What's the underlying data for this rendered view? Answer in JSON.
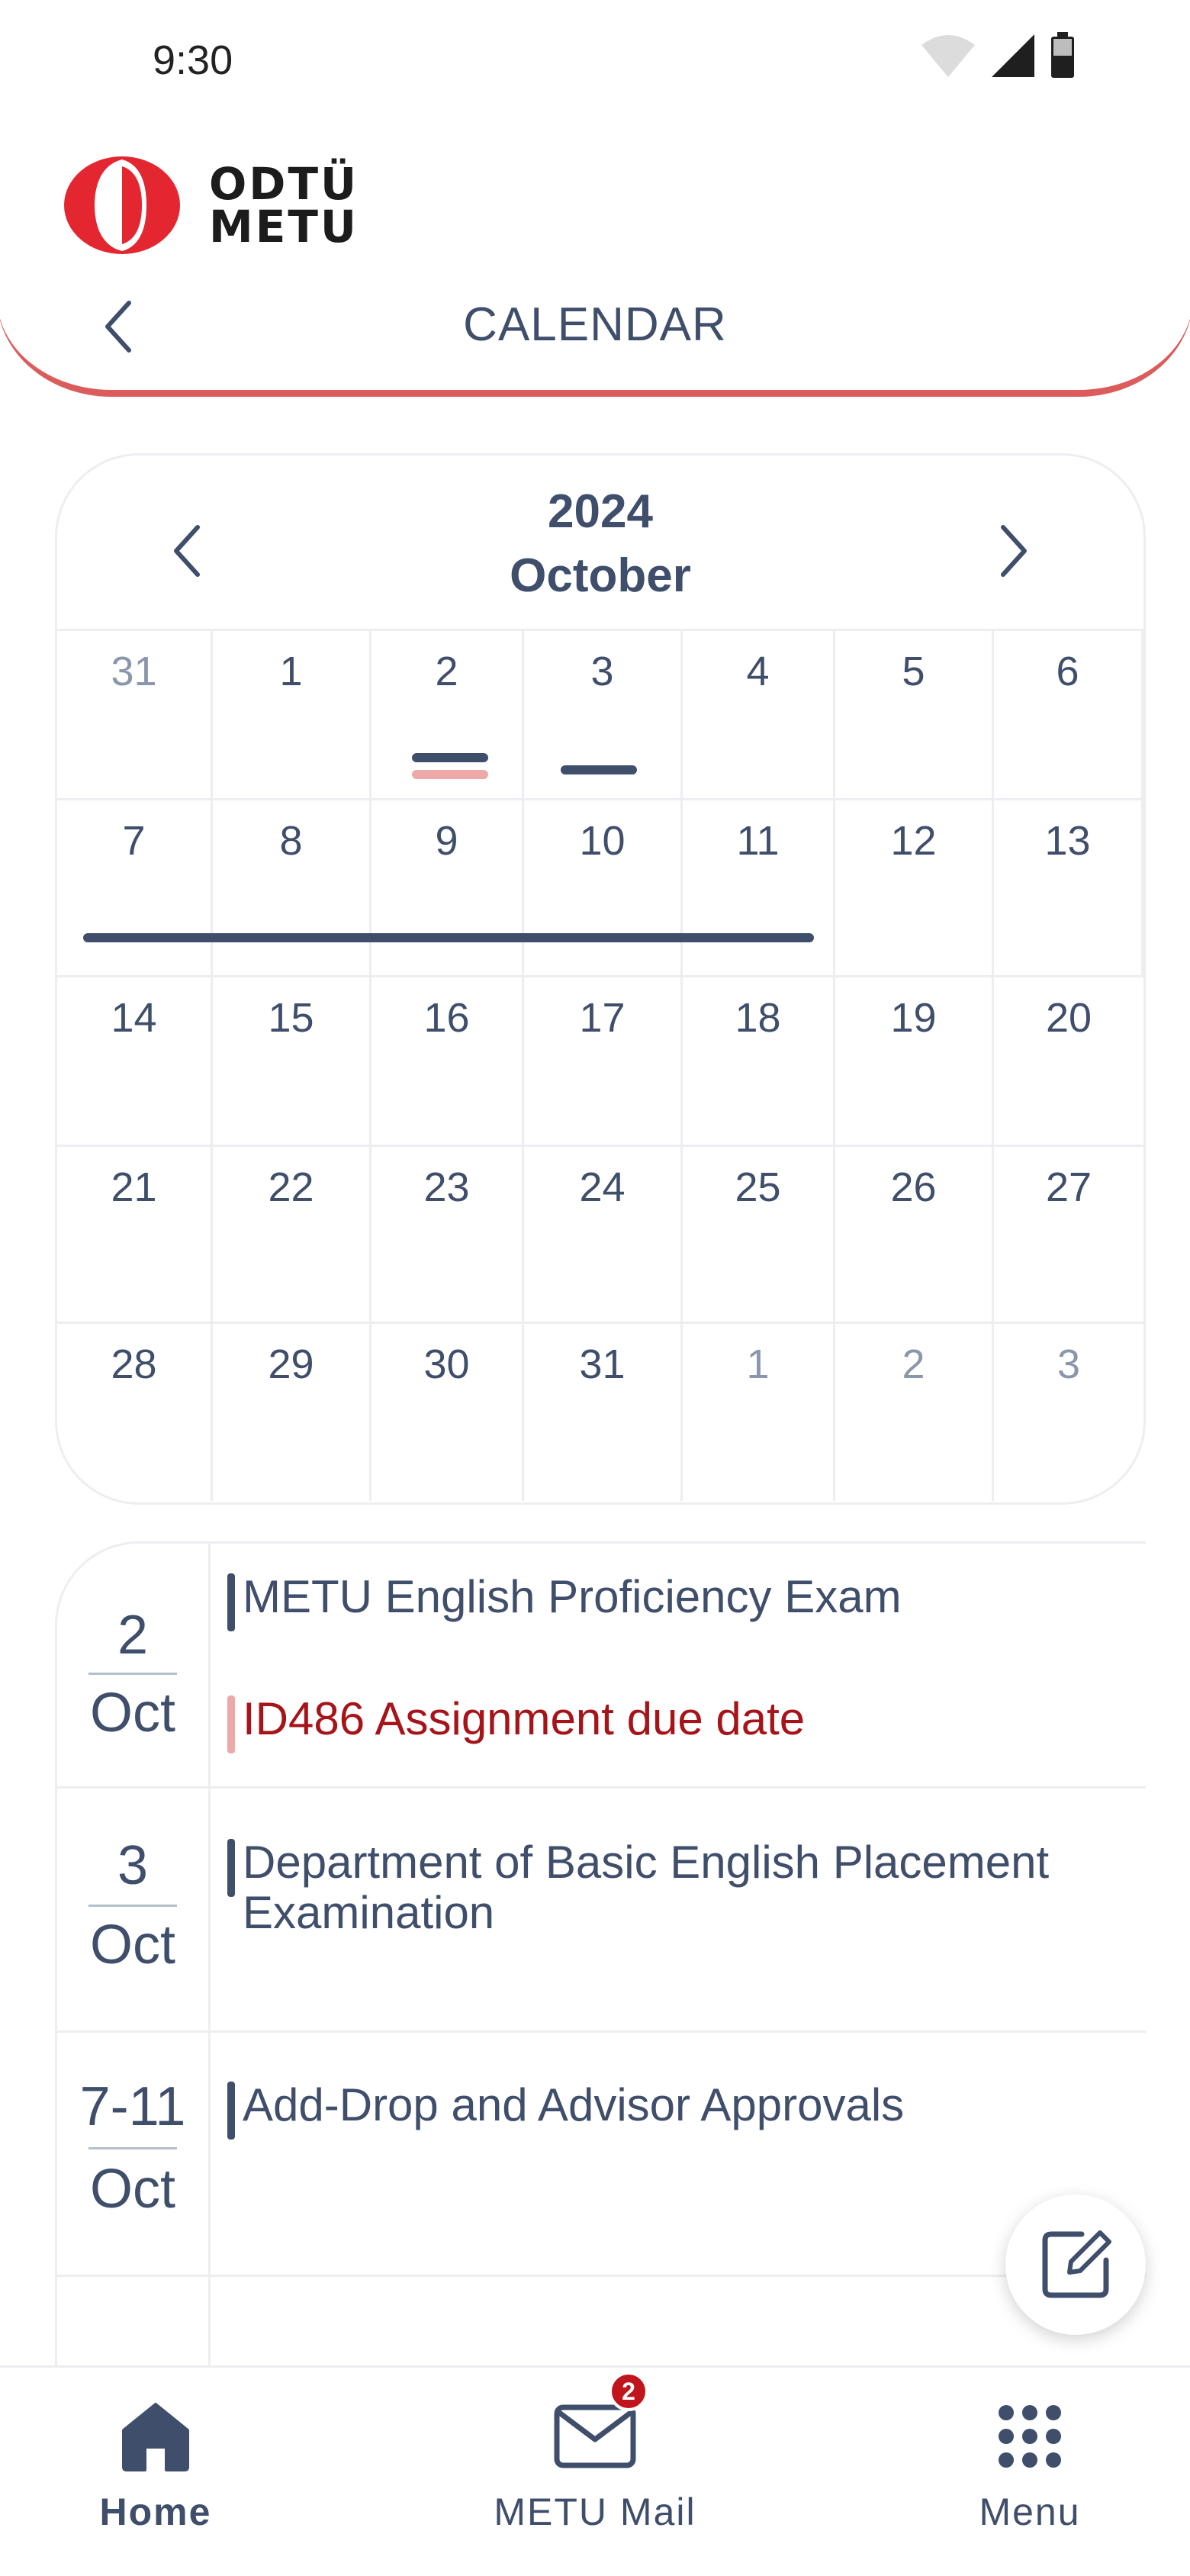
{
  "status_bar": {
    "time": "9:30"
  },
  "header": {
    "logo_line1": "ODTÜ",
    "logo_line2": "METU",
    "title": "CALENDAR",
    "accent_color": "#dc5c5c"
  },
  "calendar": {
    "year": "2024",
    "month": "October",
    "weeks": [
      [
        {
          "d": "31",
          "muted": true
        },
        {
          "d": "1"
        },
        {
          "d": "2"
        },
        {
          "d": "3"
        },
        {
          "d": "4"
        },
        {
          "d": "5"
        },
        {
          "d": "6"
        }
      ],
      [
        {
          "d": "7"
        },
        {
          "d": "8"
        },
        {
          "d": "9"
        },
        {
          "d": "10"
        },
        {
          "d": "11"
        },
        {
          "d": "12"
        },
        {
          "d": "13"
        }
      ],
      [
        {
          "d": "14"
        },
        {
          "d": "15"
        },
        {
          "d": "16"
        },
        {
          "d": "17"
        },
        {
          "d": "18"
        },
        {
          "d": "19"
        },
        {
          "d": "20"
        }
      ],
      [
        {
          "d": "21"
        },
        {
          "d": "22"
        },
        {
          "d": "23"
        },
        {
          "d": "24"
        },
        {
          "d": "25"
        },
        {
          "d": "26"
        },
        {
          "d": "27"
        }
      ],
      [
        {
          "d": "28"
        },
        {
          "d": "29"
        },
        {
          "d": "30"
        },
        {
          "d": "31"
        },
        {
          "d": "1",
          "muted": true
        },
        {
          "d": "2",
          "muted": true
        },
        {
          "d": "3",
          "muted": true
        }
      ]
    ]
  },
  "events": [
    {
      "day": "2",
      "month": "Oct",
      "items": [
        {
          "title": "METU English Proficiency Exam",
          "color": "#3f4e6b"
        },
        {
          "title": "ID486 Assignment due date",
          "color": "#eda8a8",
          "red": true
        }
      ]
    },
    {
      "day": "3",
      "month": "Oct",
      "items": [
        {
          "title": "Department of Basic English Placement Examination",
          "color": "#3f4e6b"
        }
      ]
    },
    {
      "day": "7-11",
      "month": "Oct",
      "items": [
        {
          "title": "Add-Drop and Advisor Approvals",
          "color": "#3f4e6b"
        }
      ]
    }
  ],
  "bottom_nav": {
    "home": "Home",
    "mail": "METU Mail",
    "mail_badge": "2",
    "menu": "Menu"
  }
}
